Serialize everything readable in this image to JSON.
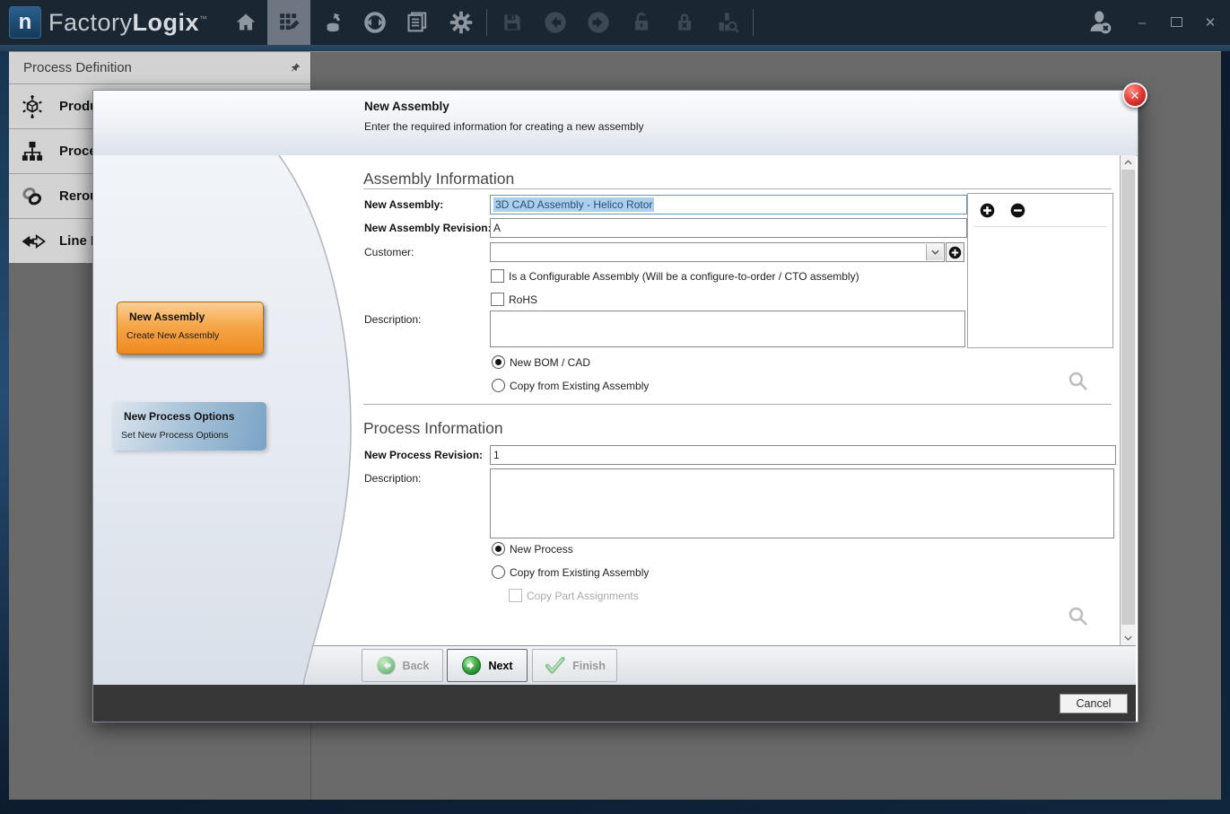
{
  "titlebar": {
    "logo_letter": "n",
    "brand_factory": "Factory",
    "brand_logix": "Logix",
    "trademark": "™",
    "minimize_glyph": "–",
    "close_glyph": "✕"
  },
  "icons": {
    "home-icon": "house",
    "design-icon": "grid-with-pencil",
    "import-icon": "database-with-arrow",
    "sync-icon": "circle-with-arrows",
    "documents-icon": "stacked-windows",
    "settings-icon": "gear",
    "save-icon": "floppy-disk",
    "back-circle-icon": "circle-left-arrow",
    "forward-circle-icon": "circle-right-arrow",
    "unlock-icon": "open-padlock",
    "lock-cancel-icon": "padlock-with-x",
    "analysis-icon": "chart-with-magnifier",
    "user-logout-icon": "person-with-x-badge",
    "pin-icon": "pushpin",
    "search-icon": "magnifier",
    "add-icon": "black-circle-plus",
    "remove-icon": "black-circle-minus"
  },
  "panel": {
    "title": "Process Definition",
    "items": [
      {
        "label": "Produc"
      },
      {
        "label": "Proces"
      },
      {
        "label": "Rerout"
      },
      {
        "label": "Line Pr"
      }
    ]
  },
  "wizard_steps": [
    {
      "title": "New Assembly",
      "subtitle": "Create New Assembly",
      "accent": "#ef8a1f"
    },
    {
      "title": "New Process Options",
      "subtitle": "Set New Process Options",
      "accent": "#7ba3c6"
    }
  ],
  "dialog": {
    "title": "New Assembly",
    "subtitle": "Enter the required information for creating a new assembly",
    "assembly": {
      "section_title": "Assembly Information",
      "new_assembly_label": "New Assembly:",
      "new_assembly_value": "3D CAD Assembly - Helico Rotor",
      "revision_label": "New Assembly Revision:",
      "revision_value": "A",
      "customer_label": "Customer:",
      "configurable_checkbox_label": "Is a Configurable Assembly (Will be a configure-to-order / CTO assembly)",
      "rohs_checkbox_label": "RoHS",
      "description_label": "Description:",
      "radio_new_bom_label": "New BOM / CAD",
      "radio_copy_existing_label": "Copy from Existing Assembly"
    },
    "process": {
      "section_title": "Process Information",
      "revision_label": "New Process Revision:",
      "revision_value": "1",
      "description_label": "Description:",
      "radio_new_process_label": "New Process",
      "radio_copy_existing_label": "Copy from Existing Assembly",
      "copy_part_assignments_label": "Copy Part Assignments"
    },
    "buttons": {
      "back": "Back",
      "next": "Next",
      "finish": "Finish",
      "cancel": "Cancel"
    }
  },
  "colors": {
    "titlebar_bg": "#1b2633",
    "workspace_bg": "#6a6a6a",
    "panel_bg": "#d3d3d3",
    "step_active_orange": "#ef8a1f",
    "step_next_blue": "#7ba3c6",
    "selection_highlight": "#a9d1ef",
    "wizard_button_green": "#2d9b35",
    "close_button_red": "#e53935",
    "dark_bar": "#373737"
  }
}
